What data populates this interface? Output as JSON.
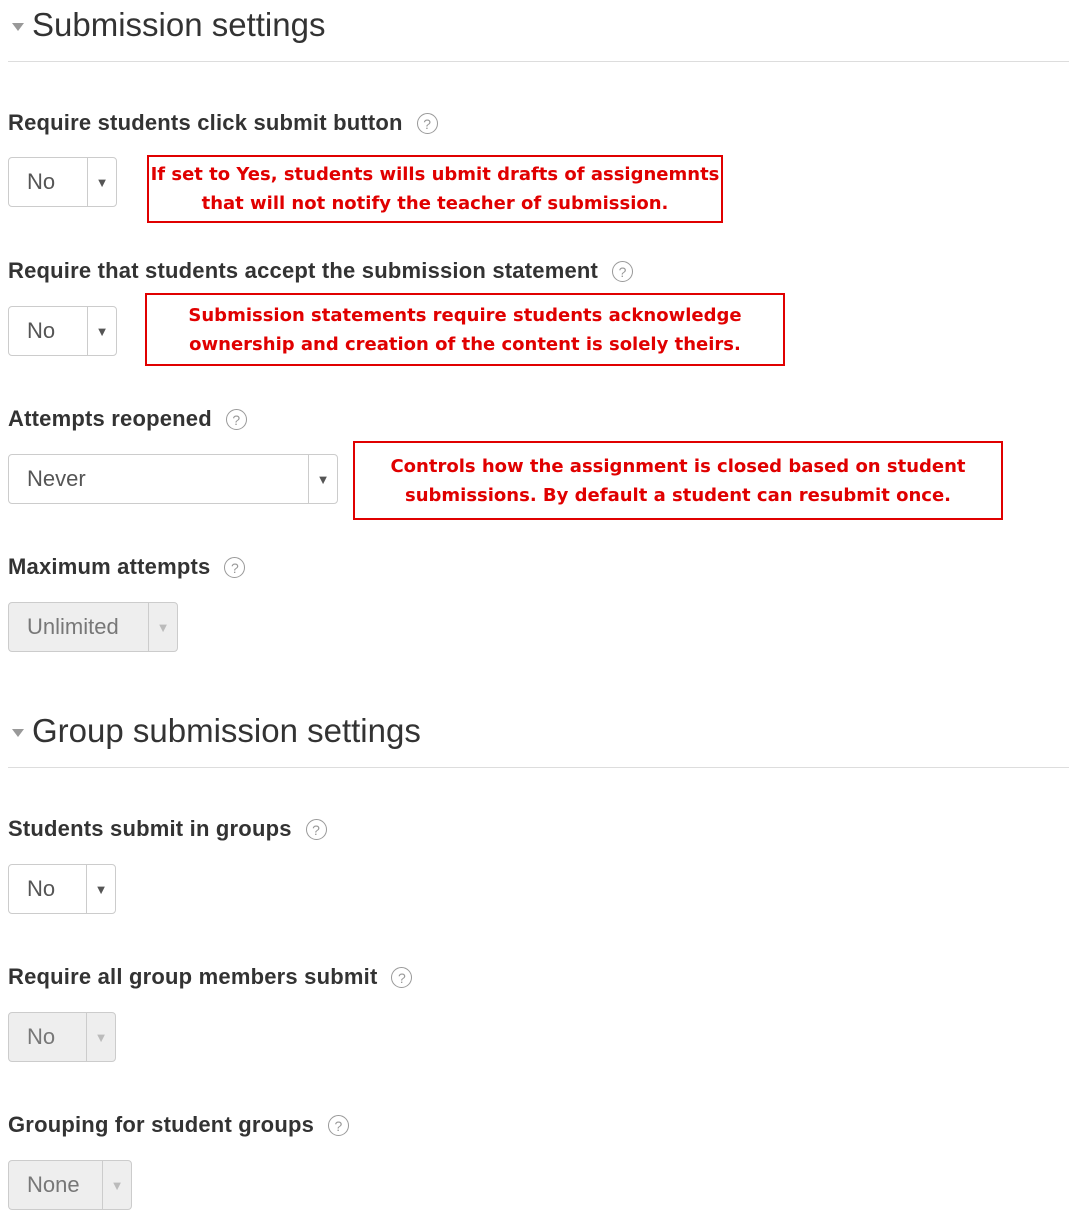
{
  "submission_section": {
    "title": "Submission settings",
    "fields": [
      {
        "label": "Require students click submit button",
        "value": "No",
        "help_icon": "help-circle-icon"
      },
      {
        "label": "Require that students accept the submission statement",
        "value": "No",
        "help_icon": "help-circle-icon"
      },
      {
        "label": "Attempts reopened",
        "value": "Never",
        "help_icon": "help-circle-icon"
      },
      {
        "label": "Maximum attempts",
        "value": "Unlimited",
        "disabled": true,
        "help_icon": "help-circle-icon"
      }
    ],
    "notes": [
      {
        "line1": "If set to Yes, students wills ubmit drafts of assignemnts",
        "line2": "that will not notify the teacher of submission."
      },
      {
        "line1": "Submission statements require students acknowledge",
        "line2": "ownership and creation of the content is solely theirs."
      },
      {
        "line1": "Controls how the assignment is closed based on student",
        "line2": "submissions.  By default a student can resubmit once."
      }
    ]
  },
  "group_section": {
    "title": "Group submission settings",
    "fields": [
      {
        "label": "Students submit in groups",
        "value": "No",
        "help_icon": "help-circle-icon"
      },
      {
        "label": "Require all group members submit",
        "value": "No",
        "disabled": true,
        "help_icon": "help-circle-icon"
      },
      {
        "label": "Grouping for student groups",
        "value": "None",
        "disabled": true,
        "help_icon": "help-circle-icon"
      }
    ]
  },
  "help_glyph": "?",
  "colors": {
    "annotation": "#e00000",
    "disabled_bg": "#eeeeee",
    "border": "#cccccc"
  }
}
